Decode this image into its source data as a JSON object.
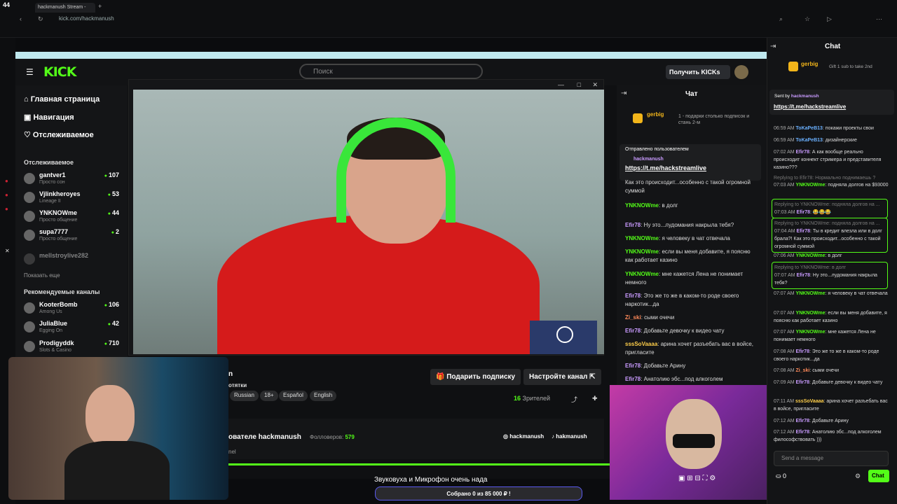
{
  "browser": {
    "tab_count": "44",
    "tab_title": "hackmanush Stream -",
    "url": "kick.com/hackmanush"
  },
  "kick": {
    "logo": "KICK",
    "search_placeholder": "Поиск",
    "get_kicks": "Получить KICKs",
    "nav": [
      "Главная страница",
      "Навигация",
      "Отслеживаемое"
    ],
    "following_title": "Отслеживаемое",
    "following": [
      {
        "name": "gantver1",
        "sub": "Просто сон",
        "viewers": "107"
      },
      {
        "name": "Vjlinkheroyes",
        "sub": "Lineage II",
        "viewers": "53"
      },
      {
        "name": "YNKNOWme",
        "sub": "Просто общение",
        "viewers": "44"
      },
      {
        "name": "supa7777",
        "sub": "Просто общение",
        "viewers": "2"
      },
      {
        "name": "mellstroylive282",
        "sub": "",
        "viewers": ""
      }
    ],
    "show_more": "Показать еще",
    "recommended_title": "Рекомендуемые каналы",
    "recommended": [
      {
        "name": "KooterBomb",
        "sub": "Among Us",
        "viewers": "106"
      },
      {
        "name": "JuliaBlue",
        "sub": "Egging On",
        "viewers": "42"
      },
      {
        "name": "Prodigyddk",
        "sub": "Slots & Casino",
        "viewers": "710"
      }
    ],
    "gift_sub": "Подарить подписку",
    "setup_channel": "Настройте канал",
    "tags": [
      "Russian",
      "18+",
      "Español",
      "English"
    ],
    "viewers": "16",
    "viewers_label": "Зрителей",
    "about_prefix": "ователе hackmanush",
    "followers_label": "Фолловеров:",
    "followers": "579",
    "social1": "hackmanush",
    "social2": "hakmanush",
    "stream_fragment": "отятки",
    "channel_fragment": "nel"
  },
  "inner_chat": {
    "title": "Чат",
    "gifter": "gerbig",
    "gift_text": "1 - подарки столько подписок и стань 2-м",
    "pinned_label": "Отправлено пользователем",
    "pinned_user": "hackmanush",
    "pinned_link": "https://t.me/hackstreamlive",
    "messages": [
      {
        "user": "",
        "text": "Как это происходит...особенно с такой огромной суммой"
      },
      {
        "user": "YNKNOWme",
        "text": ": в долг"
      },
      {
        "user": "Efir78",
        "text": ": Ну это...лудомания накрыла тебя?"
      },
      {
        "user": "YNKNOWme",
        "text": ": я человеку в чат отвечала"
      },
      {
        "user": "YNKNOWme",
        "text": ": если вы меня добавите, я поясню как работает казино"
      },
      {
        "user": "YNKNOWme",
        "text": ": мне кажется Лена не понимает немного"
      },
      {
        "user": "Efir78",
        "text": ": Это же то же в каком-то роде своего наркотик...да"
      },
      {
        "user": "Zi_ski",
        "text": ": сыми очечи"
      },
      {
        "user": "Efir78",
        "text": ": Добавьте девочку к видео чату"
      },
      {
        "user": "sssSoVaaaa",
        "text": ": арина хочет разъебать вас в войсе, пригласите"
      },
      {
        "user": "Efir78",
        "text": ": Добавьте Арину"
      },
      {
        "user": "Efir78",
        "text": ": Анатолию эбс...под алкоголем"
      }
    ]
  },
  "right_chat": {
    "title": "Chat",
    "gifter": "gerbig",
    "gift_text": "Gift 1 sub to take 2nd",
    "pinned_label": "Sent by",
    "pinned_user": "hackmanush",
    "pinned_link": "https://t.me/hackstreamlive",
    "messages": [
      {
        "time": "06:59 AM",
        "user": "ToKaPeB13",
        "text": ": покажи проекты свои"
      },
      {
        "time": "06:59 AM",
        "user": "ToKaPeB13",
        "text": ": дизайнерские"
      },
      {
        "time": "07:02 AM",
        "user": "Efir78",
        "text": ": А как вообще реально происходит коннект стримера и представителя казино???"
      },
      {
        "time": "07:03 AM",
        "user": "YNKNOWme",
        "text": ": подняла долгов на $93000"
      },
      {
        "time": "07:03 AM",
        "user": "Efir78",
        "text": ": 😂😂😂"
      },
      {
        "time": "07:04 AM",
        "user": "Efir78",
        "text": ": Ты в кредит влезла или в долг брала?! Как это происходит...особенно с такой огромной суммой"
      },
      {
        "time": "07:06 AM",
        "user": "YNKNOWme",
        "text": ": в долг"
      },
      {
        "time": "07:07 AM",
        "user": "Efir78",
        "text": ": Ну это...лудомания накрыла тебя?"
      },
      {
        "time": "07:07 AM",
        "user": "YNKNOWme",
        "text": ": я человеку в чат отвечала"
      },
      {
        "time": "07:07 AM",
        "user": "YNKNOWme",
        "text": ": если вы меня добавите, я поясню как работает казино"
      },
      {
        "time": "07:07 AM",
        "user": "YNKNOWme",
        "text": ": мне кажется Лена не понимает немного"
      },
      {
        "time": "07:08 AM",
        "user": "Efir78",
        "text": ": Это же то же в каком-то роде своего наркотик...да"
      },
      {
        "time": "07:08 AM",
        "user": "Zi_ski",
        "text": ": сыми очечи"
      },
      {
        "time": "07:09 AM",
        "user": "Efir78",
        "text": ": Добавьте девочку к видео чату"
      },
      {
        "time": "07:11 AM",
        "user": "sssSoVaaaa",
        "text": ": арина хочет разъебать вас в войсе, пригласите"
      },
      {
        "time": "07:12 AM",
        "user": "Efir78",
        "text": ": Добавьте Арину"
      },
      {
        "time": "07:12 AM",
        "user": "Efir78",
        "text": ": Анатолию эбс...под алкоголем философствовать )))"
      }
    ],
    "reply1": "Replying to Efir78: Нормально поднимаешь ?",
    "reply2": "Replying to YNKNOWme: подняла долгов на ...",
    "reply3": "Replying to YNKNOWme: подняла долгов на ...",
    "reply4": "Replying to YNKNOWme: в долг",
    "input_placeholder": "Send a message",
    "points": "0",
    "chat_button": "Chat"
  },
  "donation": {
    "title": "Звуковуха и Микрофон очень нада",
    "progress": "Собрано 0  из 85 000 ₽ !"
  },
  "colors": {
    "kick_green": "#53fc18",
    "efir": "#c99bff",
    "ynk": "#53fc18",
    "toka": "#6ab0ff",
    "zi": "#ff8a5a",
    "sss": "#ffcf4a"
  }
}
